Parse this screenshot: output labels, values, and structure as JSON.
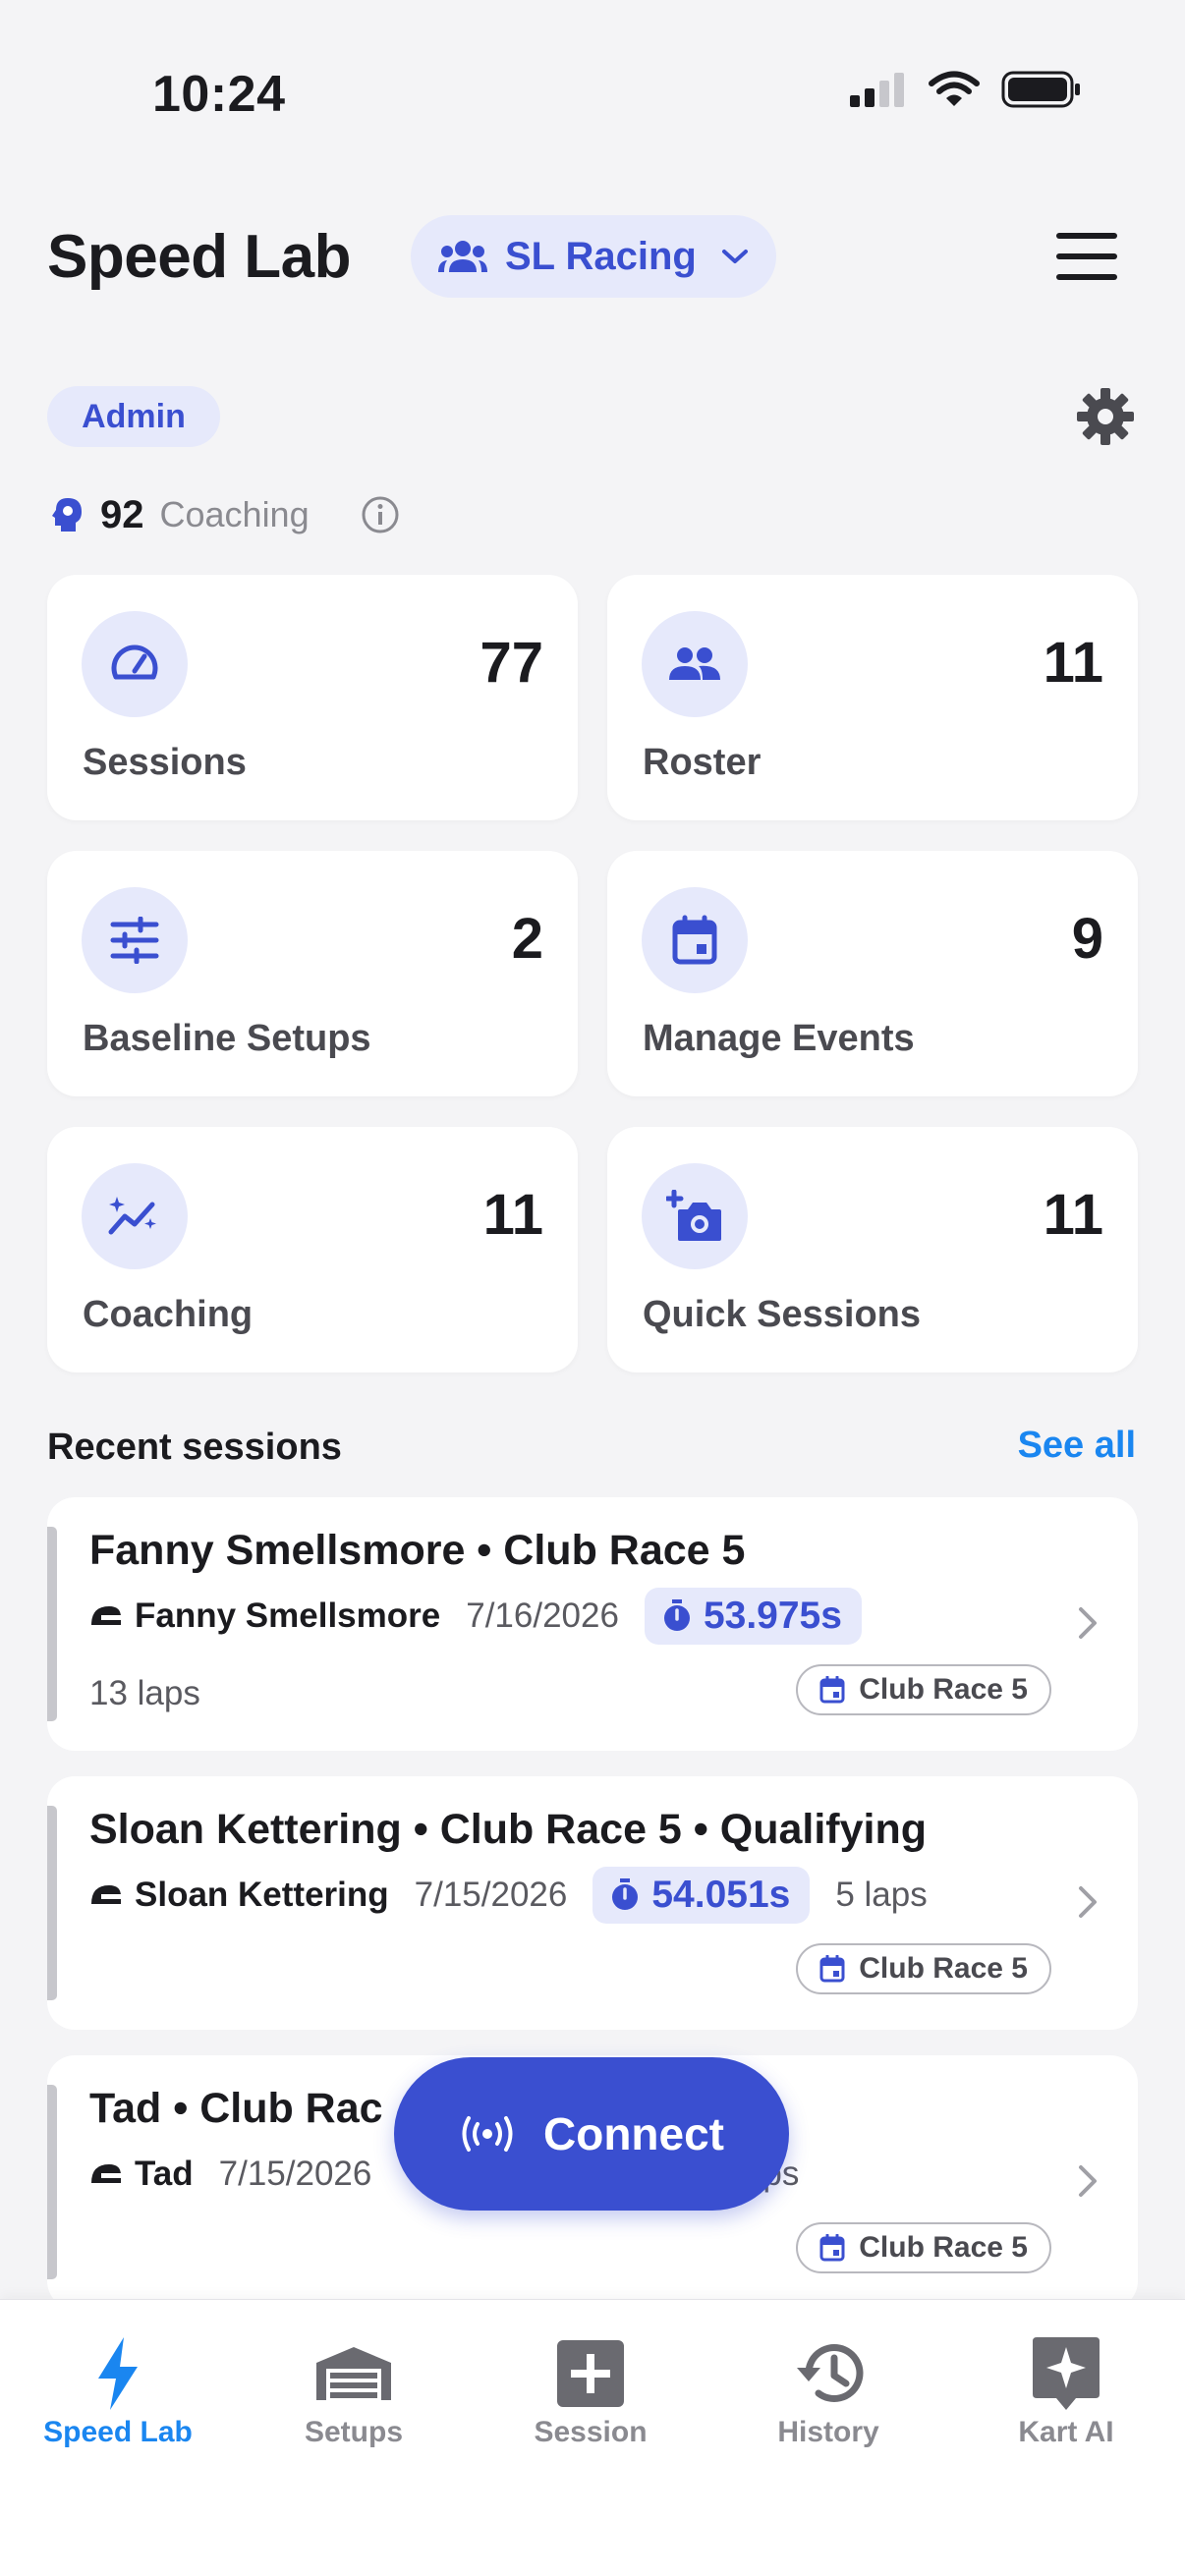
{
  "status_bar": {
    "time": "10:24"
  },
  "header": {
    "title": "Speed Lab",
    "team_name": "SL Racing"
  },
  "role_badge": "Admin",
  "coaching_score": {
    "value": "92",
    "label": "Coaching"
  },
  "stats": [
    {
      "label": "Sessions",
      "value": "77",
      "icon": "speedometer-icon"
    },
    {
      "label": "Roster",
      "value": "11",
      "icon": "group-icon"
    },
    {
      "label": "Baseline Setups",
      "value": "2",
      "icon": "sliders-icon"
    },
    {
      "label": "Manage Events",
      "value": "9",
      "icon": "calendar-icon"
    },
    {
      "label": "Coaching",
      "value": "11",
      "icon": "sparkle-chart-icon"
    },
    {
      "label": "Quick Sessions",
      "value": "11",
      "icon": "camera-plus-icon"
    }
  ],
  "recent": {
    "title": "Recent sessions",
    "see_all": "See all",
    "sessions": [
      {
        "title": "Fanny Smellsmore • Club Race 5",
        "driver": "Fanny Smellsmore",
        "date": "7/16/2026",
        "best_lap": "53.975s",
        "laps": "13 laps",
        "event": "Club Race 5"
      },
      {
        "title": "Sloan Kettering • Club Race 5 • Qualifying",
        "driver": "Sloan Kettering",
        "date": "7/15/2026",
        "best_lap": "54.051s",
        "laps": "5 laps",
        "event": "Club Race 5"
      },
      {
        "title": "Tad • Club Rac",
        "driver": "Tad",
        "date": "7/15/2026",
        "laps_partial": "ps",
        "event": "Club Race 5"
      }
    ]
  },
  "connect_button": "Connect",
  "tabs": [
    {
      "label": "Speed Lab",
      "icon": "bolt-icon",
      "active": true
    },
    {
      "label": "Setups",
      "icon": "garage-icon"
    },
    {
      "label": "Session",
      "icon": "plus-square-icon"
    },
    {
      "label": "History",
      "icon": "history-icon"
    },
    {
      "label": "Kart AI",
      "icon": "sparkle-icon"
    }
  ],
  "colors": {
    "accent": "#3a4fd0",
    "link": "#1a86f0",
    "pill_bg": "#e6e9fb",
    "background": "#f4f4f6"
  }
}
